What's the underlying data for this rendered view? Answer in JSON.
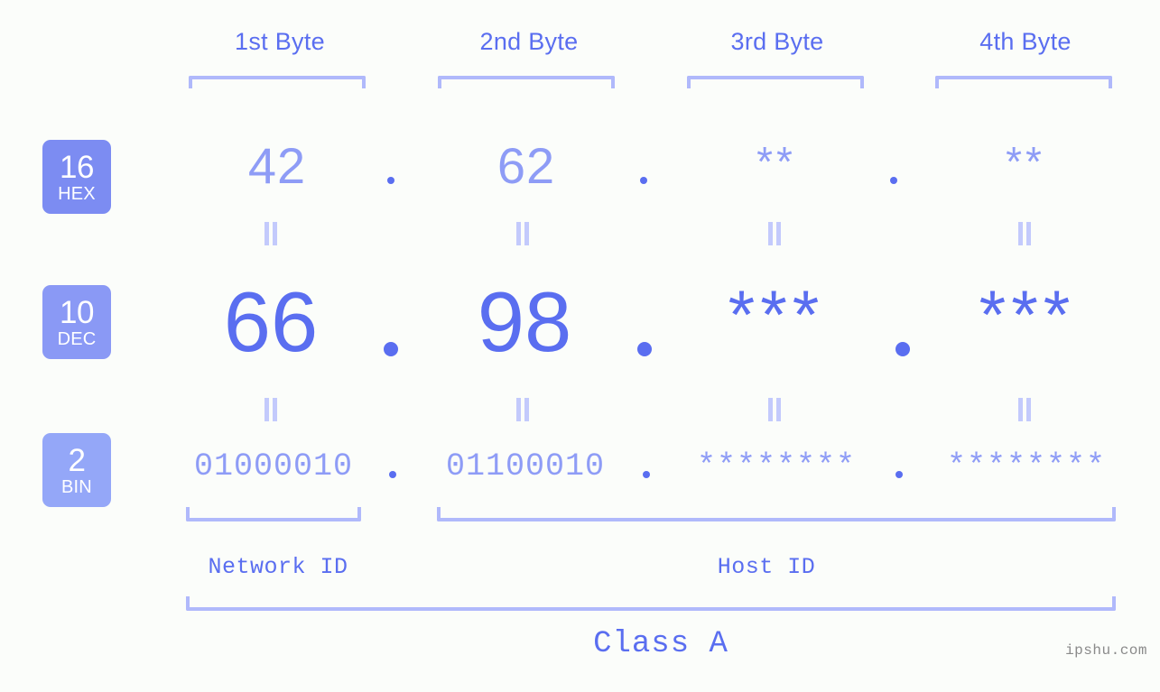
{
  "meta": {
    "background": "#fbfdfa",
    "accent_strong": "#5a6ef0",
    "accent_mid": "#8e9cf6",
    "accent_light": "#b0b9fb",
    "watermark": "ipshu.com"
  },
  "headers": [
    {
      "label": "1st Byte"
    },
    {
      "label": "2nd Byte"
    },
    {
      "label": "3rd Byte"
    },
    {
      "label": "4th Byte"
    }
  ],
  "bases": [
    {
      "num": "16",
      "abbr": "HEX",
      "color": "#7c8cf2"
    },
    {
      "num": "10",
      "abbr": "DEC",
      "color": "#8a99f5"
    },
    {
      "num": "2",
      "abbr": "BIN",
      "color": "#94a7f8"
    }
  ],
  "rows": {
    "hex": {
      "values": [
        "42",
        "62",
        "**",
        "**"
      ]
    },
    "dec": {
      "values": [
        "66",
        "98",
        "***",
        "***"
      ]
    },
    "bin": {
      "values": [
        "01000010",
        "01100010",
        "********",
        "********"
      ]
    }
  },
  "separators": {
    "dot": "."
  },
  "equals_mark": "=",
  "segments": [
    {
      "label": "Network ID"
    },
    {
      "label": "Host ID"
    }
  ],
  "class": {
    "label": "Class A"
  }
}
